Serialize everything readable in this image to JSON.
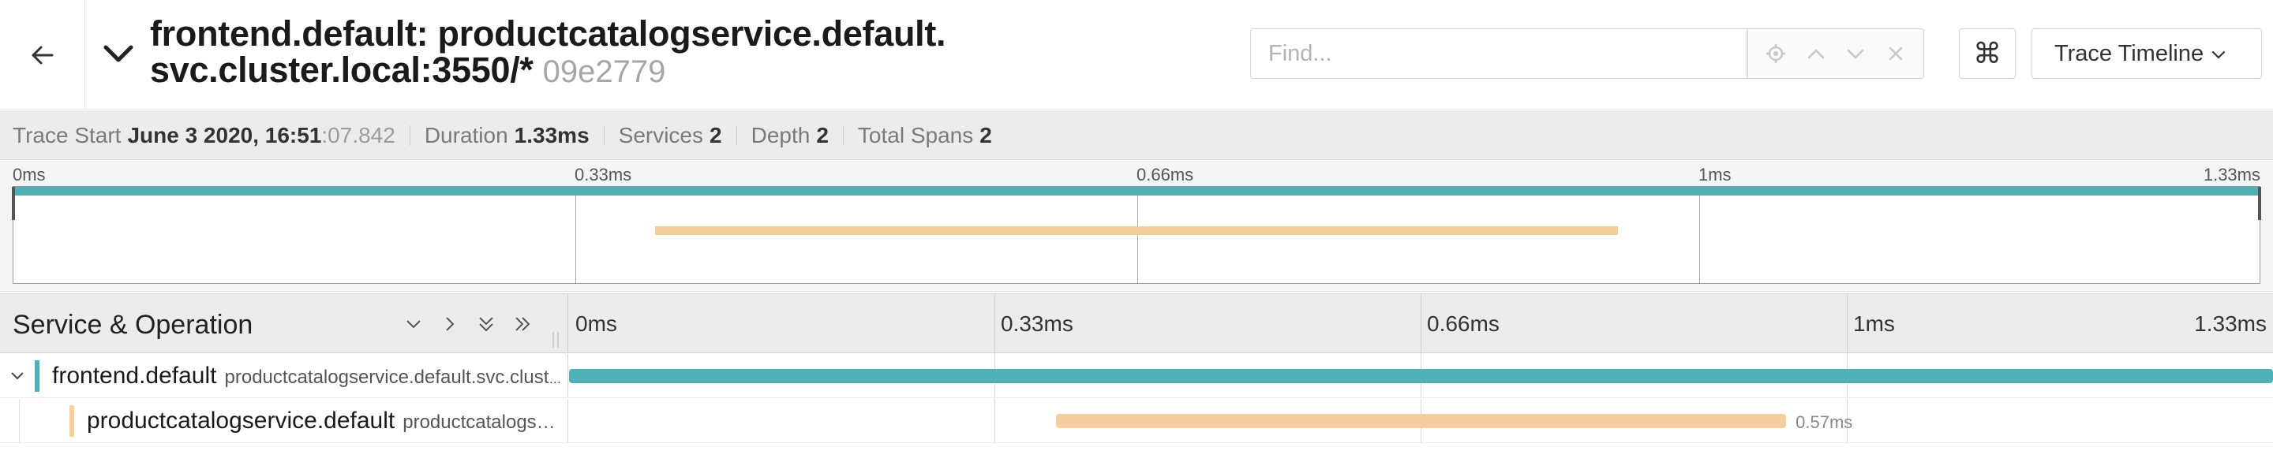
{
  "header": {
    "title_line1": "frontend.default: productcatalogservice.default.",
    "title_line2": "svc.cluster.local:3550/*",
    "trace_id": "09e2779",
    "back_icon": "arrow-left-icon",
    "collapse_icon": "chevron-down-icon"
  },
  "search": {
    "placeholder": "Find...",
    "value": ""
  },
  "shortcut_icon": "command-key-icon",
  "view_select": {
    "label": "Trace Timeline"
  },
  "summary": {
    "trace_start_label": "Trace Start",
    "trace_start_date": "June 3 2020, 16:51",
    "trace_start_seconds": ":07.842",
    "duration_label": "Duration",
    "duration_value": "1.33ms",
    "services_label": "Services",
    "services_value": "2",
    "depth_label": "Depth",
    "depth_value": "2",
    "total_spans_label": "Total Spans",
    "total_spans_value": "2"
  },
  "minimap": {
    "ticks": [
      "0ms",
      "0.33ms",
      "0.66ms",
      "1ms",
      "1.33ms"
    ]
  },
  "timeline": {
    "column_title": "Service & Operation",
    "ticks": [
      "0ms",
      "0.33ms",
      "0.66ms",
      "1ms",
      "1.33ms"
    ],
    "total_duration_ms": 1.33,
    "spans": [
      {
        "service": "frontend.default",
        "operation": "productcatalogservice.default.svc.clust…",
        "color": "#4fb0b8",
        "start_ms": 0,
        "duration_ms": 1.33,
        "depth": 0,
        "duration_label": ""
      },
      {
        "service": "productcatalogservice.default",
        "operation": "productcatalogs…",
        "color": "#f6cd9f",
        "start_ms": 0.38,
        "duration_ms": 0.57,
        "depth": 1,
        "duration_label": "0.57ms"
      }
    ]
  },
  "colors": {
    "frontend": "#4fb0b8",
    "productcatalog": "#f6cd9f"
  }
}
